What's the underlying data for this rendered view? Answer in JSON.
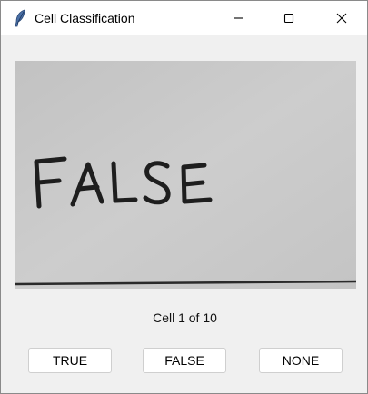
{
  "window": {
    "title": "Cell Classification",
    "icons": {
      "app": "feather-icon",
      "minimize": "minimize-icon",
      "maximize": "maximize-icon",
      "close": "close-icon"
    }
  },
  "cell_image": {
    "handwritten_text": "FALSE"
  },
  "status": {
    "text": "Cell 1 of 10"
  },
  "buttons": {
    "true_label": "TRUE",
    "false_label": "FALSE",
    "none_label": "NONE"
  }
}
